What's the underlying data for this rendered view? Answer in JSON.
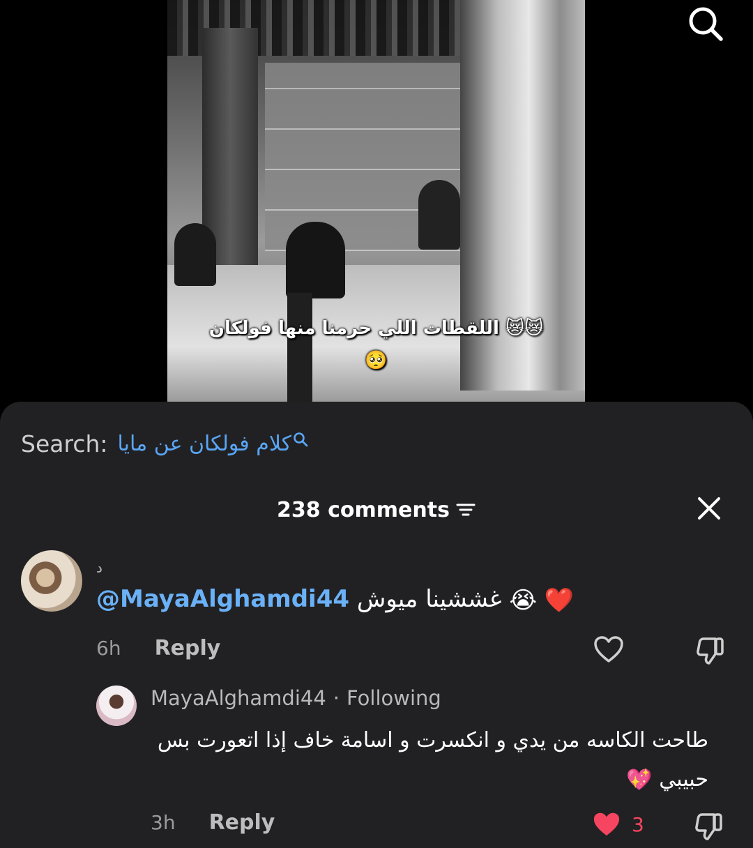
{
  "video": {
    "caption_line1": "😿😿 اللقطات اللي حرمنا منها فولكان",
    "caption_line2": "🥺"
  },
  "icons": {
    "top_search": "search-icon",
    "sort": "sort-icon",
    "close": "close-icon",
    "like": "heart-icon",
    "dislike": "dislike-icon",
    "query": "magnifier-icon"
  },
  "search": {
    "label": "Search:",
    "query": "كلام فولكان عن مايا"
  },
  "comments": {
    "count_label": "238 comments",
    "list": [
      {
        "username": "د",
        "mention": "@MayaAlghamdi44",
        "text": "غششينا ميوش",
        "emojis": "😭 ❤️",
        "time": "6h",
        "reply_label": "Reply"
      },
      {
        "username": "MayaAlghamdi44",
        "separator": "·",
        "status": "Following",
        "text_line1": "طاحت الكاسه من يدي و انكسرت و اسامة خاف إذا اتعورت بس",
        "text_line2": "حبيبي",
        "emoji": "💖",
        "time": "3h",
        "reply_label": "Reply",
        "likes": "3"
      }
    ]
  },
  "colors": {
    "sheet_bg": "#212123",
    "mention": "#6ab1f7",
    "like_active": "#f64560",
    "muted_text": "#9b9b9b"
  }
}
